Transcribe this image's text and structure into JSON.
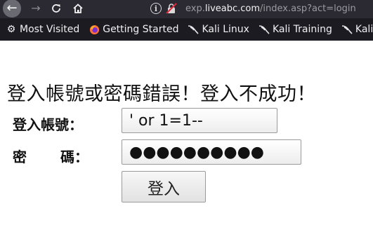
{
  "browser": {
    "url_prefix": "exp.",
    "url_domain": "liveabc.com",
    "url_path": "/index.asp?act=login",
    "bookmarks": [
      {
        "label": "Most Visited",
        "icon": "gear-icon"
      },
      {
        "label": "Getting Started",
        "icon": "firefox-icon"
      },
      {
        "label": "Kali Linux",
        "icon": "kali-dragon-icon"
      },
      {
        "label": "Kali Training",
        "icon": "kali-dragon-icon"
      },
      {
        "label": "Kali Too",
        "icon": "kali-dragon-icon"
      }
    ]
  },
  "page": {
    "error_message": "登入帳號或密碼錯誤！登入不成功！",
    "account_label": "登入帳號：",
    "password_label_start": "密",
    "password_label_end": "碼：",
    "account_value": "' or 1=1--",
    "password_value": "●●●●●●●●●●",
    "submit_label": "登入"
  },
  "colors": {
    "toolbar": "#2b2a33",
    "bookmarks_bar": "#1c1b22",
    "page_background": "#ffffff"
  }
}
